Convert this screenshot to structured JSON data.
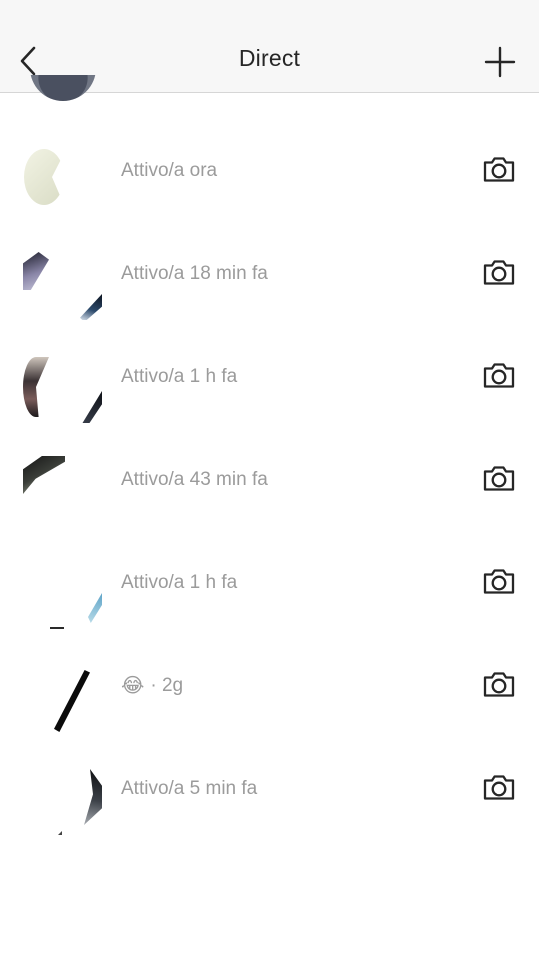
{
  "header": {
    "title": "Direct",
    "back_icon": "chevron-left-icon",
    "add_icon": "plus-icon"
  },
  "conversations": [
    {
      "status": "Attivo/a ora",
      "camera_icon": "camera-icon"
    },
    {
      "status": "Attivo/a 18 min fa",
      "camera_icon": "camera-icon"
    },
    {
      "status": "Attivo/a 1 h fa",
      "camera_icon": "camera-icon"
    },
    {
      "status": "Attivo/a 43 min fa",
      "camera_icon": "camera-icon"
    },
    {
      "status": "Attivo/a 1 h fa",
      "camera_icon": "camera-icon"
    },
    {
      "status_emoji": "😂",
      "status_time": "· 2g",
      "camera_icon": "camera-icon"
    },
    {
      "status": "Attivo/a 5 min fa",
      "camera_icon": "camera-icon"
    }
  ],
  "colors": {
    "header_bg": "#f7f7f7",
    "title_text": "#262626",
    "status_text": "#9b9b9b",
    "icon": "#262626"
  }
}
